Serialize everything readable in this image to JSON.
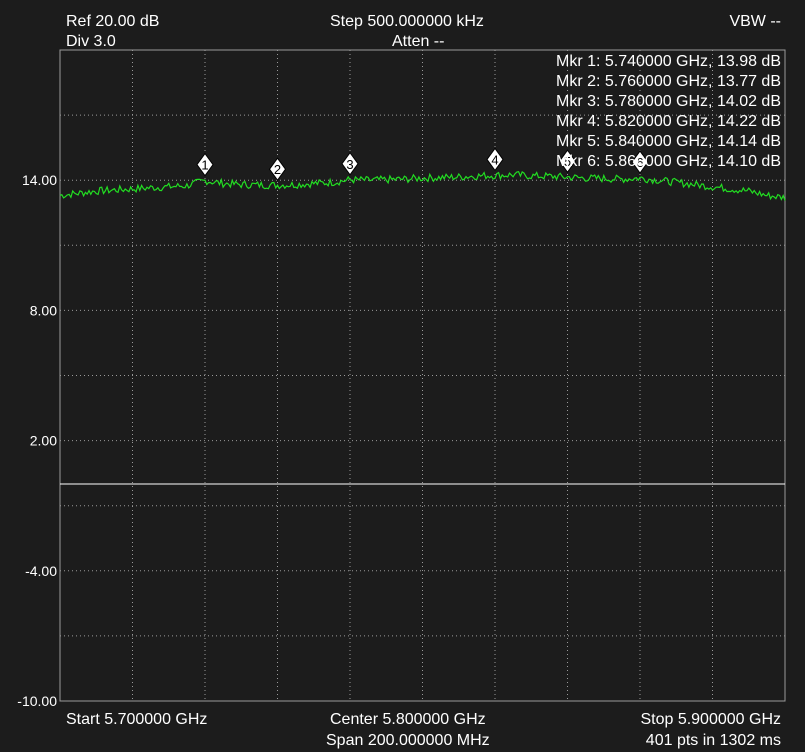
{
  "header": {
    "ref": "Ref 20.00 dB",
    "div": "Div 3.0",
    "step": "Step 500.000000 kHz",
    "atten": "Atten --",
    "vbw": "VBW --"
  },
  "footer": {
    "start": "Start 5.700000 GHz",
    "center": "Center 5.800000 GHz",
    "span": "Span 200.000000 MHz",
    "stop": "Stop 5.900000 GHz",
    "points": "401 pts in 1302 ms"
  },
  "markers_text": [
    "Mkr 1: 5.740000 GHz, 13.98 dB",
    "Mkr 2: 5.760000 GHz, 13.77 dB",
    "Mkr 3: 5.780000 GHz, 14.02 dB",
    "Mkr 4: 5.820000 GHz, 14.22 dB",
    "Mkr 5: 5.840000 GHz, 14.14 dB",
    "Mkr 6: 5.860000 GHz, 14.10 dB"
  ],
  "colors": {
    "background": "#1c1c1c",
    "trace": "#22dd22",
    "grid": "#9a9a9a",
    "reference_line": "#ffffff",
    "text": "#ffffff"
  },
  "chart_data": {
    "type": "line",
    "title": "",
    "xlabel": "",
    "ylabel": "",
    "x_unit": "GHz",
    "y_unit": "dB",
    "xlim": [
      5.7,
      5.9
    ],
    "ylim": [
      -10,
      20
    ],
    "y_tick_labels": [
      "14.00",
      "8.00",
      "2.00",
      "-4.00",
      "-10.00"
    ],
    "y_tick_values": [
      14,
      8,
      2,
      -4,
      -10
    ],
    "grid": true,
    "reference_level": 0,
    "series": [
      {
        "x": [
          5.7,
          5.705,
          5.71,
          5.715,
          5.72,
          5.725,
          5.73,
          5.735,
          5.74,
          5.745,
          5.75,
          5.755,
          5.76,
          5.765,
          5.77,
          5.775,
          5.78,
          5.785,
          5.79,
          5.795,
          5.8,
          5.805,
          5.81,
          5.815,
          5.82,
          5.825,
          5.83,
          5.835,
          5.84,
          5.845,
          5.85,
          5.855,
          5.86,
          5.865,
          5.87,
          5.875,
          5.88,
          5.885,
          5.89,
          5.895,
          5.9
        ],
        "values": [
          13.3,
          13.4,
          13.5,
          13.55,
          13.6,
          13.65,
          13.7,
          13.75,
          13.98,
          13.85,
          13.8,
          13.78,
          13.77,
          13.8,
          13.85,
          13.9,
          14.02,
          14.0,
          14.02,
          14.05,
          14.1,
          14.12,
          14.15,
          14.2,
          14.22,
          14.25,
          14.2,
          14.18,
          14.14,
          14.1,
          14.08,
          14.05,
          14.1,
          14.0,
          13.9,
          13.8,
          13.7,
          13.6,
          13.5,
          13.3,
          13.2
        ]
      }
    ],
    "markers": [
      {
        "label": "1",
        "x": 5.74,
        "y": 13.98
      },
      {
        "label": "2",
        "x": 5.76,
        "y": 13.77
      },
      {
        "label": "3",
        "x": 5.78,
        "y": 14.02
      },
      {
        "label": "4",
        "x": 5.82,
        "y": 14.22
      },
      {
        "label": "5",
        "x": 5.84,
        "y": 14.14
      },
      {
        "label": "6",
        "x": 5.86,
        "y": 14.1
      }
    ]
  }
}
